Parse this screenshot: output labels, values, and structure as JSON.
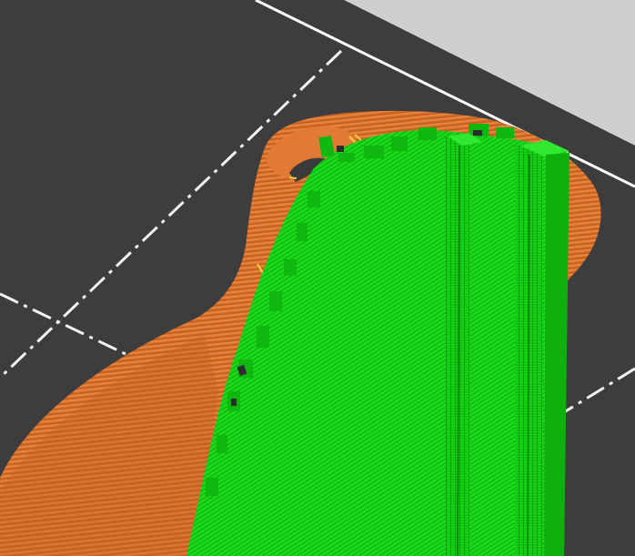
{
  "viewport": {
    "label": "",
    "background_color": "#3b3b3b"
  },
  "bed": {
    "surface_color": "#3d3d3d",
    "border_color": "#ffffff",
    "grid_line_style": "dash-dot",
    "off_bed_color": "#cfcfcf"
  },
  "model": {
    "outer_wall_color": "#d8722e",
    "outer_wall_highlight": "#e88a42",
    "infill_color": "#14d614",
    "infill_highlight": "#2ee62e",
    "seam_highlight_color": "#f2d23a"
  }
}
